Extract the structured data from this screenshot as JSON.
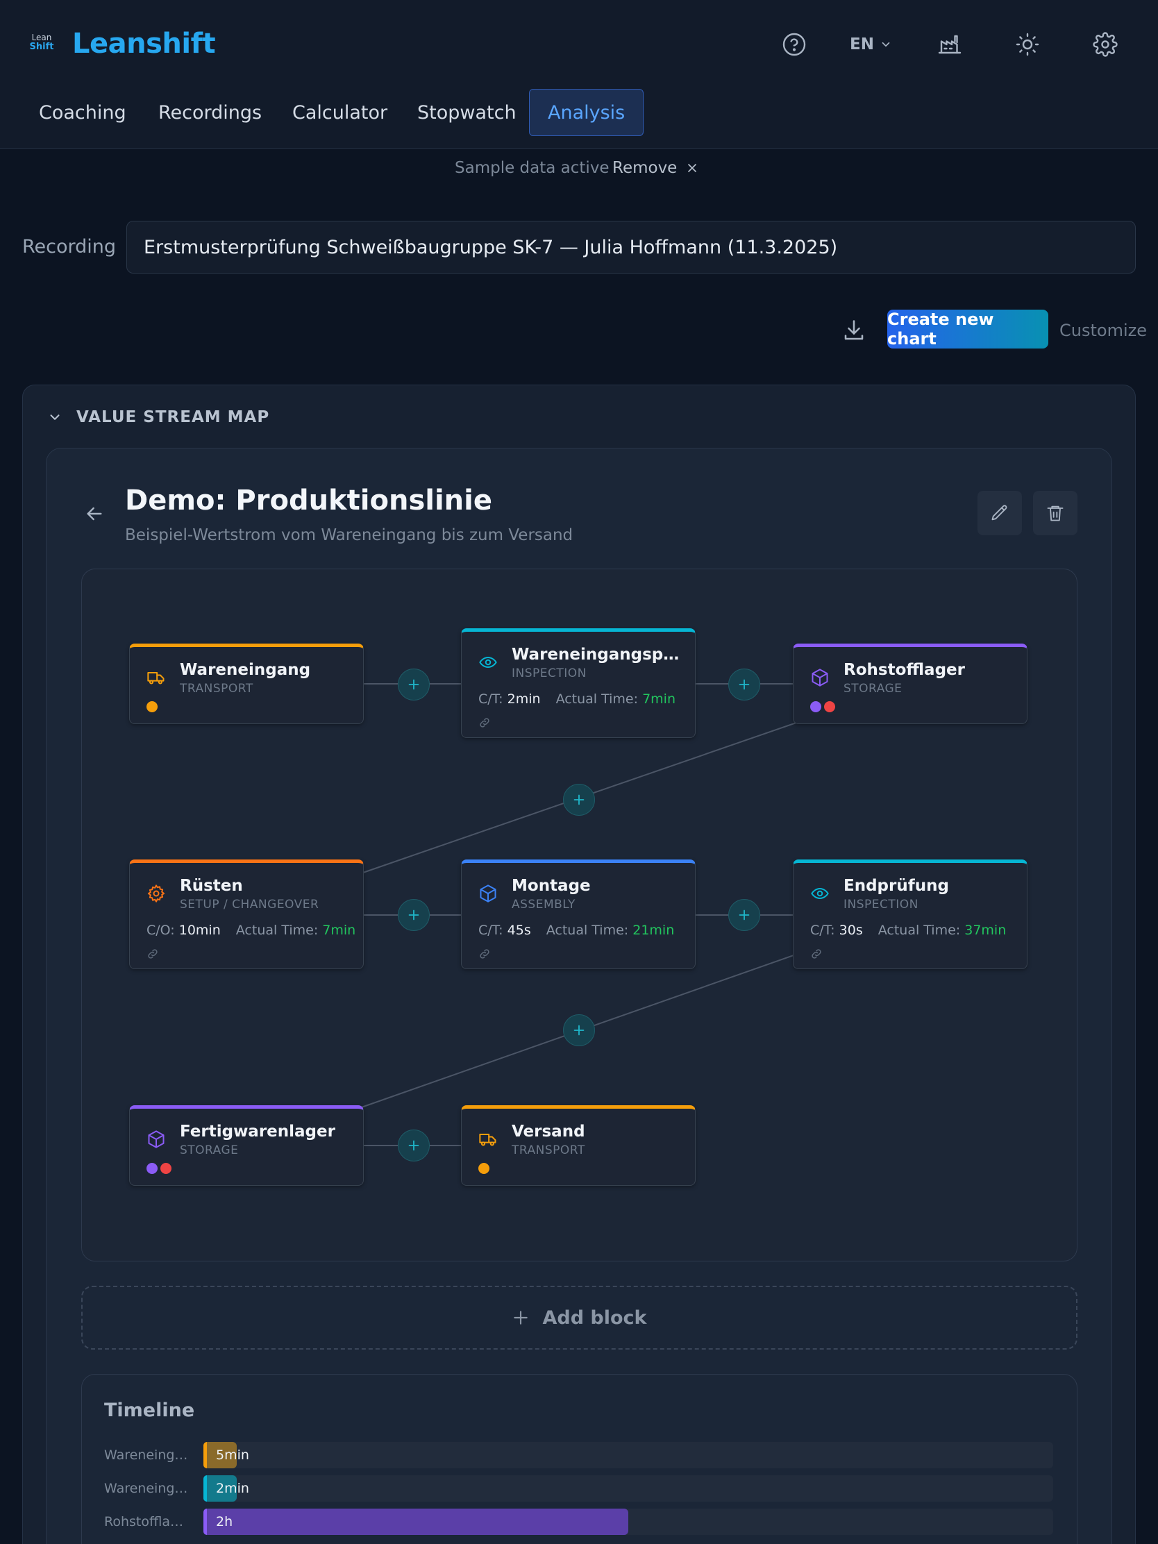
{
  "app": {
    "logo_line1": "Lean",
    "logo_line2": "Shift",
    "brand": "Leanshift",
    "language": "EN"
  },
  "nav": {
    "tabs": [
      {
        "label": "Coaching",
        "active": false
      },
      {
        "label": "Recordings",
        "active": false
      },
      {
        "label": "Calculator",
        "active": false
      },
      {
        "label": "Stopwatch",
        "active": false
      },
      {
        "label": "Analysis",
        "active": true
      }
    ]
  },
  "sample_bar": {
    "text": "Sample data active",
    "remove_label": "Remove"
  },
  "recording": {
    "label": "Recording",
    "value": "Erstmusterprüfung Schweißbaugruppe SK-7 — Julia Hoffmann (11.3.2025)"
  },
  "toolbar": {
    "create_label": "Create new chart",
    "customize_label": "Customize"
  },
  "vsm": {
    "section_title": "VALUE STREAM MAP",
    "title": "Demo: Produktionslinie",
    "subtitle": "Beispiel-Wertstrom vom Wareneingang bis zum Versand",
    "nodes": [
      {
        "title": "Wareneingang",
        "type": "TRANSPORT",
        "accent": "#f59e0b"
      },
      {
        "title": "Wareneingangsprüf...",
        "type": "INSPECTION",
        "accent": "#06b6d4",
        "metric_label": "C/T:",
        "metric_value": "2min",
        "actual_label": "Actual Time:",
        "actual_value": "7min"
      },
      {
        "title": "Rohstofflager",
        "type": "STORAGE",
        "accent": "#8b5cf6"
      },
      {
        "title": "Rüsten",
        "type": "SETUP / CHANGEOVER",
        "accent": "#f97316",
        "metric_label": "C/O:",
        "metric_value": "10min",
        "actual_label": "Actual Time:",
        "actual_value": "7min"
      },
      {
        "title": "Montage",
        "type": "ASSEMBLY",
        "accent": "#3b82f6",
        "metric_label": "C/T:",
        "metric_value": "45s",
        "actual_label": "Actual Time:",
        "actual_value": "21min"
      },
      {
        "title": "Endprüfung",
        "type": "INSPECTION",
        "accent": "#06b6d4",
        "metric_label": "C/T:",
        "metric_value": "30s",
        "actual_label": "Actual Time:",
        "actual_value": "37min"
      },
      {
        "title": "Fertigwarenlager",
        "type": "STORAGE",
        "accent": "#8b5cf6"
      },
      {
        "title": "Versand",
        "type": "TRANSPORT",
        "accent": "#f59e0b"
      }
    ],
    "dot_colors": {
      "transport": "#f59e0b",
      "storage_a": "#8b5cf6",
      "storage_b": "#ef4444"
    },
    "add_block_label": "Add block"
  },
  "timeline": {
    "title": "Timeline",
    "rows": [
      {
        "label": "Wareneinga...",
        "value": "5min",
        "color": "#8a6a2a",
        "accent": "#f59e0b",
        "fraction": 0.039
      },
      {
        "label": "Wareneinga...",
        "value": "2min",
        "color": "#137a8c",
        "accent": "#06b6d4",
        "fraction": 0.039
      },
      {
        "label": "Rohstofflager",
        "value": "2h",
        "color": "#5b3fa8",
        "accent": "#8b5cf6",
        "fraction": 0.5
      }
    ]
  }
}
